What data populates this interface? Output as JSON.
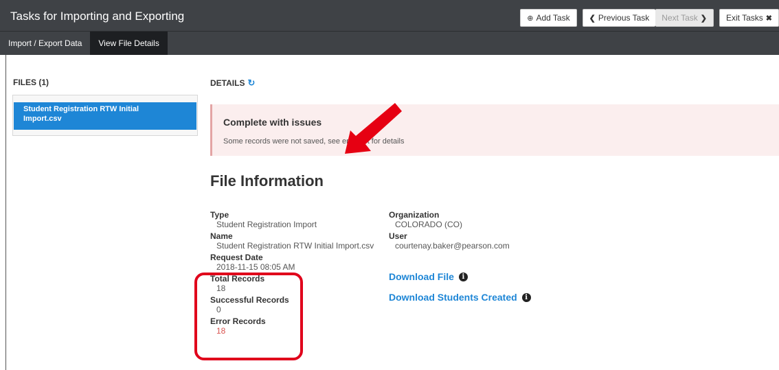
{
  "header": {
    "title": "Tasks for Importing and Exporting",
    "buttons": {
      "add_task": "Add Task",
      "previous_task": "Previous Task",
      "next_task": "Next Task",
      "exit_tasks": "Exit Tasks"
    }
  },
  "tabs": [
    {
      "label": "Import / Export Data",
      "active": false
    },
    {
      "label": "View File Details",
      "active": true
    }
  ],
  "files": {
    "heading": "FILES (1)",
    "items": [
      {
        "line1": "Student Registration RTW Initial",
        "line2": "Import.csv",
        "selected": true
      }
    ]
  },
  "details": {
    "heading": "DETAILS",
    "alert": {
      "title": "Complete with issues",
      "message": "Some records were not saved, see error list for details"
    },
    "section_title": "File Information",
    "left": {
      "type_label": "Type",
      "type_value": "Student Registration Import",
      "name_label": "Name",
      "name_value": "Student Registration RTW Initial Import.csv",
      "request_date_label": "Request Date",
      "request_date_value": "2018-11-15 08:05 AM",
      "total_label": "Total Records",
      "total_value": "18",
      "successful_label": "Successful Records",
      "successful_value": "0",
      "error_label": "Error Records",
      "error_value": "18"
    },
    "right": {
      "organization_label": "Organization",
      "organization_value": "COLORADO (CO)",
      "user_label": "User",
      "user_value": "courtenay.baker@pearson.com",
      "download_file": "Download File",
      "download_students": "Download Students Created"
    }
  },
  "colors": {
    "accent": "#1e86d6",
    "topbar": "#3f4246",
    "annotation": "#e0001b",
    "error_text": "#d9534f"
  }
}
